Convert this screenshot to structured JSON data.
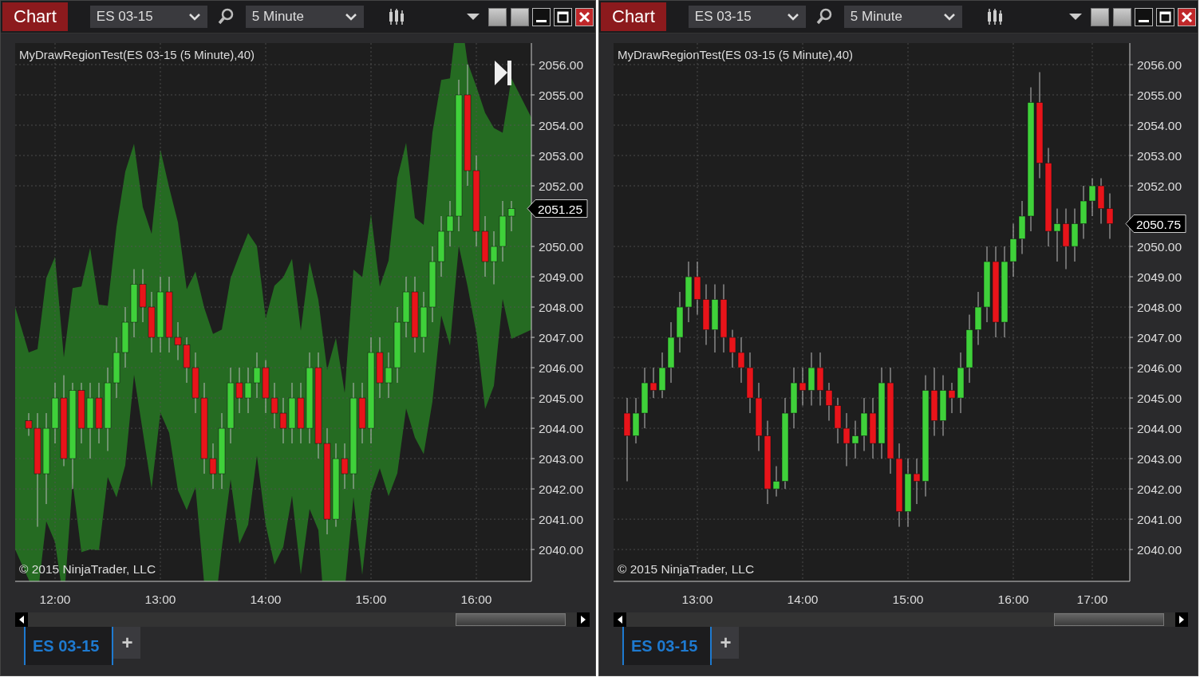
{
  "windows": [
    {
      "title": "Chart",
      "instrument": "ES 03-15",
      "interval": "5 Minute",
      "indicator_label": "MyDrawRegionTest(ES 03-15 (5 Minute),40)",
      "region_shaded": true,
      "end_button": true,
      "copyright": "© 2015 NinjaTrader, LLC",
      "last_price": "2051.25",
      "chart_data": {
        "type": "candlestick",
        "grid": true,
        "categories": [
          null,
          null,
          null,
          "12:00",
          null,
          null,
          null,
          null,
          null,
          null,
          null,
          null,
          null,
          null,
          null,
          "13:00",
          null,
          null,
          null,
          null,
          null,
          null,
          null,
          null,
          null,
          null,
          null,
          "14:00",
          null,
          null,
          null,
          null,
          null,
          null,
          null,
          null,
          null,
          null,
          null,
          "15:00",
          null,
          null,
          null,
          null,
          null,
          null,
          null,
          null,
          null,
          null,
          null,
          "16:00",
          null,
          null,
          null,
          null
        ],
        "ylim": [
          2038.95,
          2056.71
        ],
        "yticks": [
          {
            "value": 2056,
            "label": "2056.00"
          },
          {
            "value": 2055,
            "label": "2055.00"
          },
          {
            "value": 2054,
            "label": "2054.00"
          },
          {
            "value": 2053,
            "label": "2053.00"
          },
          {
            "value": 2052,
            "label": "2052.00"
          },
          {
            "value": 2050,
            "label": "2050.00"
          },
          {
            "value": 2049,
            "label": "2049.00"
          },
          {
            "value": 2048,
            "label": "2048.00"
          },
          {
            "value": 2047,
            "label": "2047.00"
          },
          {
            "value": 2046,
            "label": "2046.00"
          },
          {
            "value": 2045,
            "label": "2045.00"
          },
          {
            "value": 2044,
            "label": "2044.00"
          },
          {
            "value": 2043,
            "label": "2043.00"
          },
          {
            "value": 2042,
            "label": "2042.00"
          },
          {
            "value": 2041,
            "label": "2041.00"
          },
          {
            "value": 2040,
            "label": "2040.00"
          }
        ],
        "ohlc": [
          [
            2044.25,
            2044.5,
            2043.75,
            2044
          ],
          [
            2044,
            2044.5,
            2040.75,
            2042.5
          ],
          [
            2042.5,
            2044.5,
            2041.5,
            2044
          ],
          [
            2044,
            2045.5,
            2043.5,
            2045
          ],
          [
            2045,
            2045.75,
            2042.75,
            2043
          ],
          [
            2043,
            2045.5,
            2042,
            2045.25
          ],
          [
            2045.25,
            2045.5,
            2043.5,
            2044
          ],
          [
            2044,
            2045.5,
            2043,
            2045
          ],
          [
            2045,
            2045.5,
            2043.5,
            2044
          ],
          [
            2044,
            2046,
            2043.25,
            2045.5
          ],
          [
            2045.5,
            2047,
            2045,
            2046.5
          ],
          [
            2046.5,
            2048,
            2046,
            2047.5
          ],
          [
            2047.5,
            2049.25,
            2047,
            2048.75
          ],
          [
            2048.75,
            2049.25,
            2047.5,
            2048
          ],
          [
            2048,
            2048.5,
            2046.5,
            2047
          ],
          [
            2047,
            2049,
            2046.5,
            2048.5
          ],
          [
            2048.5,
            2049,
            2046.5,
            2047
          ],
          [
            2047,
            2047.5,
            2046.25,
            2046.75
          ],
          [
            2046.75,
            2047,
            2045.5,
            2046
          ],
          [
            2046,
            2046.5,
            2044.5,
            2045
          ],
          [
            2045,
            2045.5,
            2042.5,
            2043
          ],
          [
            2043,
            2043.5,
            2042,
            2042.5
          ],
          [
            2042.5,
            2044.5,
            2042,
            2044
          ],
          [
            2044,
            2046,
            2043.5,
            2045.5
          ],
          [
            2045.5,
            2046,
            2044.5,
            2045
          ],
          [
            2045,
            2046,
            2044.5,
            2045.5
          ],
          [
            2045.5,
            2046.5,
            2045,
            2046
          ],
          [
            2046,
            2046.25,
            2044.5,
            2045
          ],
          [
            2045,
            2045.5,
            2044,
            2044.5
          ],
          [
            2044.5,
            2045,
            2043.5,
            2044
          ],
          [
            2044,
            2045.5,
            2043.5,
            2045
          ],
          [
            2045,
            2045.5,
            2043.5,
            2044
          ],
          [
            2044,
            2046.5,
            2043.5,
            2046
          ],
          [
            2046,
            2046.5,
            2043,
            2043.5
          ],
          [
            2043.5,
            2044,
            2040.5,
            2041
          ],
          [
            2041,
            2043.5,
            2040.75,
            2043
          ],
          [
            2043,
            2043.5,
            2042,
            2042.5
          ],
          [
            2042.5,
            2045.5,
            2042,
            2045
          ],
          [
            2045,
            2045.5,
            2043.5,
            2044
          ],
          [
            2044,
            2047,
            2043.5,
            2046.5
          ],
          [
            2046.5,
            2047,
            2045,
            2045.5
          ],
          [
            2045.5,
            2046.5,
            2045,
            2046
          ],
          [
            2046,
            2048,
            2045.5,
            2047.5
          ],
          [
            2047.5,
            2049,
            2047,
            2048.5
          ],
          [
            2048.5,
            2049,
            2046.5,
            2047
          ],
          [
            2047,
            2048.5,
            2046.5,
            2048
          ],
          [
            2048,
            2050,
            2047.5,
            2049.5
          ],
          [
            2049.5,
            2051,
            2049,
            2050.5
          ],
          [
            2050.5,
            2051.5,
            2050,
            2051
          ],
          [
            2051,
            2055.5,
            2050.5,
            2055
          ],
          [
            2055,
            2056,
            2052,
            2052.5
          ],
          [
            2052.5,
            2053,
            2050,
            2050.5
          ],
          [
            2050.5,
            2051,
            2049,
            2049.5
          ],
          [
            2049.5,
            2050.5,
            2048.75,
            2050
          ],
          [
            2050,
            2051.5,
            2049.5,
            2051
          ],
          [
            2051,
            2051.5,
            2050.5,
            2051.25
          ]
        ]
      },
      "tabs": [
        {
          "label": "ES 03-15",
          "selected": true
        }
      ],
      "add_tab": "+"
    },
    {
      "title": "Chart",
      "instrument": "ES 03-15",
      "interval": "5 Minute",
      "indicator_label": "MyDrawRegionTest(ES 03-15 (5 Minute),40)",
      "region_shaded": false,
      "end_button": false,
      "copyright": "© 2015 NinjaTrader, LLC",
      "last_price": "2050.75",
      "chart_data": {
        "type": "candlestick",
        "grid": true,
        "categories": [
          null,
          null,
          null,
          null,
          null,
          null,
          null,
          null,
          "13:00",
          null,
          null,
          null,
          null,
          null,
          null,
          null,
          null,
          null,
          null,
          null,
          "14:00",
          null,
          null,
          null,
          null,
          null,
          null,
          null,
          null,
          null,
          null,
          null,
          "15:00",
          null,
          null,
          null,
          null,
          null,
          null,
          null,
          null,
          null,
          null,
          null,
          "16:00",
          null,
          null,
          null,
          null,
          null,
          null,
          null,
          null,
          "17:00",
          null,
          null
        ],
        "ylim": [
          2038.95,
          2056.71
        ],
        "yticks": [
          {
            "value": 2056,
            "label": "2056.00"
          },
          {
            "value": 2055,
            "label": "2055.00"
          },
          {
            "value": 2054,
            "label": "2054.00"
          },
          {
            "value": 2053,
            "label": "2053.00"
          },
          {
            "value": 2052,
            "label": "2052.00"
          },
          {
            "value": 2050,
            "label": "2050.00"
          },
          {
            "value": 2049,
            "label": "2049.00"
          },
          {
            "value": 2048,
            "label": "2048.00"
          },
          {
            "value": 2047,
            "label": "2047.00"
          },
          {
            "value": 2046,
            "label": "2046.00"
          },
          {
            "value": 2045,
            "label": "2045.00"
          },
          {
            "value": 2044,
            "label": "2044.00"
          },
          {
            "value": 2043,
            "label": "2043.00"
          },
          {
            "value": 2042,
            "label": "2042.00"
          },
          {
            "value": 2041,
            "label": "2041.00"
          },
          {
            "value": 2040,
            "label": "2040.00"
          }
        ],
        "ohlc": [
          [
            2044.5,
            2045,
            2042.25,
            2043.75
          ],
          [
            2043.75,
            2045,
            2043.5,
            2044.5
          ],
          [
            2044.5,
            2046,
            2044,
            2045.5
          ],
          [
            2045.5,
            2046,
            2045,
            2045.25
          ],
          [
            2045.25,
            2046.5,
            2045,
            2046
          ],
          [
            2046,
            2047.5,
            2045.5,
            2047
          ],
          [
            2047,
            2048.5,
            2046.5,
            2048
          ],
          [
            2048,
            2049.5,
            2047.5,
            2049
          ],
          [
            2049,
            2049.5,
            2047.75,
            2048.25
          ],
          [
            2048.25,
            2048.75,
            2046.75,
            2047.25
          ],
          [
            2047.25,
            2048.75,
            2046.5,
            2048.25
          ],
          [
            2048.25,
            2048.75,
            2046.5,
            2047
          ],
          [
            2047,
            2047.25,
            2046,
            2046.5
          ],
          [
            2046.5,
            2047,
            2045.5,
            2046
          ],
          [
            2046,
            2046.5,
            2044.5,
            2045
          ],
          [
            2045,
            2045.5,
            2043.25,
            2043.75
          ],
          [
            2043.75,
            2044.25,
            2041.5,
            2042
          ],
          [
            2042,
            2042.75,
            2041.75,
            2042.25
          ],
          [
            2042.25,
            2045,
            2042,
            2044.5
          ],
          [
            2044.5,
            2046,
            2044,
            2045.5
          ],
          [
            2045.5,
            2046,
            2044.75,
            2045.25
          ],
          [
            2045.25,
            2046.5,
            2044.75,
            2046
          ],
          [
            2046,
            2046.5,
            2044.75,
            2045.25
          ],
          [
            2045.25,
            2045.5,
            2044.25,
            2044.75
          ],
          [
            2044.75,
            2045,
            2043.5,
            2044
          ],
          [
            2044,
            2044.5,
            2042.75,
            2043.5
          ],
          [
            2043.5,
            2044.25,
            2043,
            2043.75
          ],
          [
            2043.75,
            2045,
            2043.25,
            2044.5
          ],
          [
            2044.5,
            2045,
            2043,
            2043.5
          ],
          [
            2043.5,
            2046,
            2043,
            2045.5
          ],
          [
            2045.5,
            2046,
            2042.5,
            2043
          ],
          [
            2043,
            2043.5,
            2040.75,
            2041.25
          ],
          [
            2041.25,
            2043,
            2040.75,
            2042.5
          ],
          [
            2042.5,
            2043,
            2041.5,
            2042.25
          ],
          [
            2042.25,
            2045.75,
            2041.75,
            2045.25
          ],
          [
            2045.25,
            2046,
            2043.75,
            2044.25
          ],
          [
            2044.25,
            2045.75,
            2043.75,
            2045.25
          ],
          [
            2045.25,
            2045.5,
            2044.5,
            2045
          ],
          [
            2045,
            2046.5,
            2044.5,
            2046
          ],
          [
            2046,
            2047.75,
            2045.5,
            2047.25
          ],
          [
            2047.25,
            2048.5,
            2046.75,
            2048
          ],
          [
            2048,
            2050,
            2047.5,
            2049.5
          ],
          [
            2049.5,
            2050,
            2047,
            2047.5
          ],
          [
            2047.5,
            2050,
            2047,
            2049.5
          ],
          [
            2049.5,
            2050.75,
            2049,
            2050.25
          ],
          [
            2050.25,
            2051.5,
            2049.75,
            2051
          ],
          [
            2051,
            2055.25,
            2050.5,
            2054.75
          ],
          [
            2054.75,
            2055.75,
            2052.25,
            2052.75
          ],
          [
            2052.75,
            2053.25,
            2050,
            2050.5
          ],
          [
            2050.5,
            2051.25,
            2049.5,
            2050.75
          ],
          [
            2050.75,
            2051.25,
            2049.25,
            2050
          ],
          [
            2050,
            2051.25,
            2049.5,
            2050.75
          ],
          [
            2050.75,
            2052,
            2050.25,
            2051.5
          ],
          [
            2051.5,
            2052.25,
            2051,
            2052
          ],
          [
            2052,
            2052.25,
            2050.75,
            2051.25
          ],
          [
            2051.25,
            2051.75,
            2050.25,
            2050.75
          ]
        ]
      },
      "tabs": [
        {
          "label": "ES 03-15",
          "selected": true
        }
      ],
      "add_tab": "+"
    }
  ]
}
